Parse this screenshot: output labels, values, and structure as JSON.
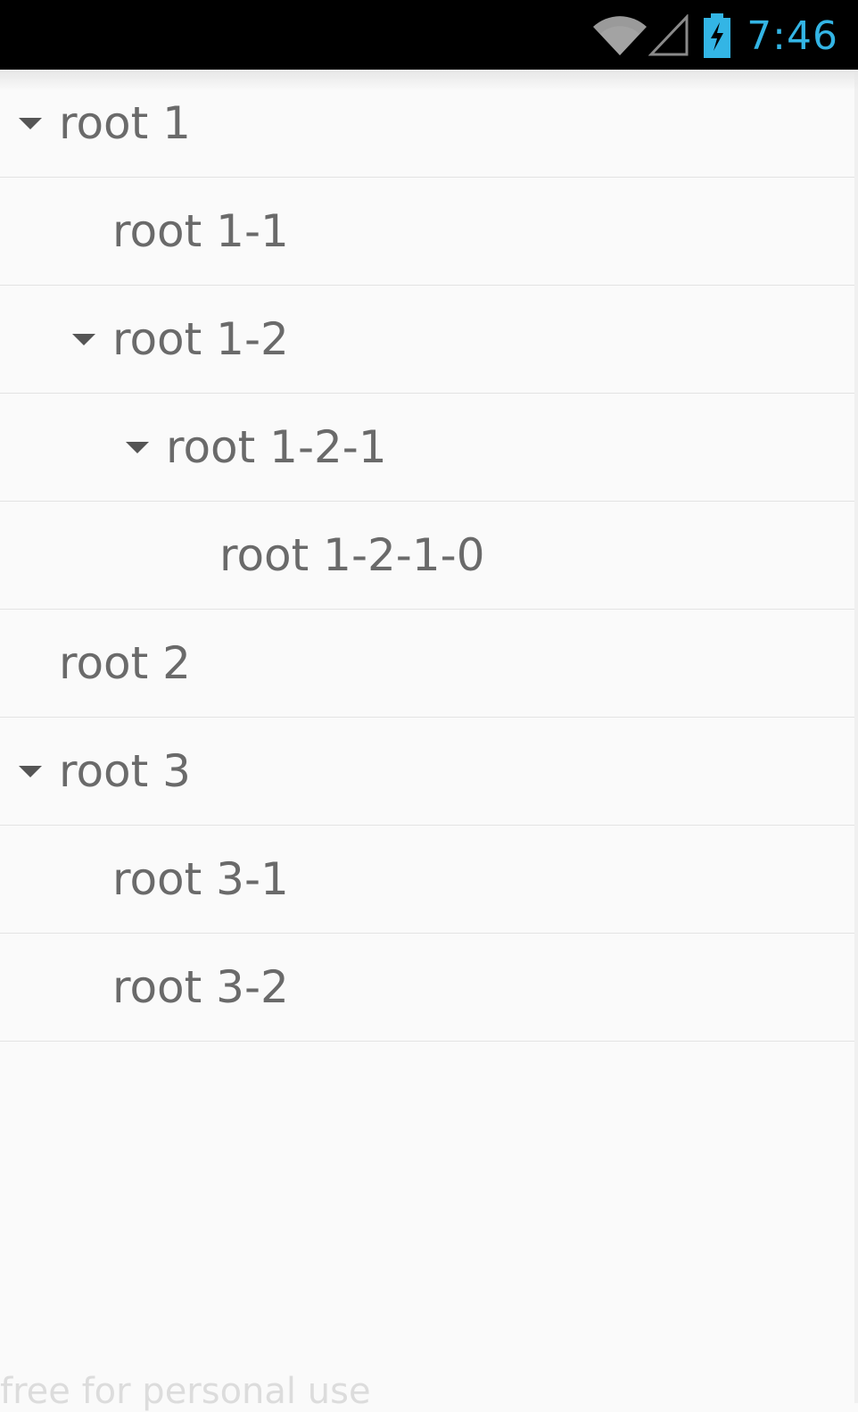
{
  "status_bar": {
    "time": "7:46",
    "icons": [
      "wifi-icon",
      "cell-signal-icon",
      "battery-charging-icon"
    ],
    "time_color": "#33b5e5",
    "background": "#000000"
  },
  "tree": {
    "rows": [
      {
        "label": "root 1",
        "depth": 0,
        "expanded": true
      },
      {
        "label": "root 1-1",
        "depth": 1,
        "expanded": false
      },
      {
        "label": "root 1-2",
        "depth": 1,
        "expanded": true
      },
      {
        "label": "root 1-2-1",
        "depth": 2,
        "expanded": true
      },
      {
        "label": "root 1-2-1-0",
        "depth": 3,
        "expanded": false
      },
      {
        "label": "root 2",
        "depth": 0,
        "expanded": false
      },
      {
        "label": "root 3",
        "depth": 0,
        "expanded": true
      },
      {
        "label": "root 3-1",
        "depth": 1,
        "expanded": false
      },
      {
        "label": "root 3-2",
        "depth": 1,
        "expanded": false
      }
    ]
  },
  "watermark": "free for personal use"
}
